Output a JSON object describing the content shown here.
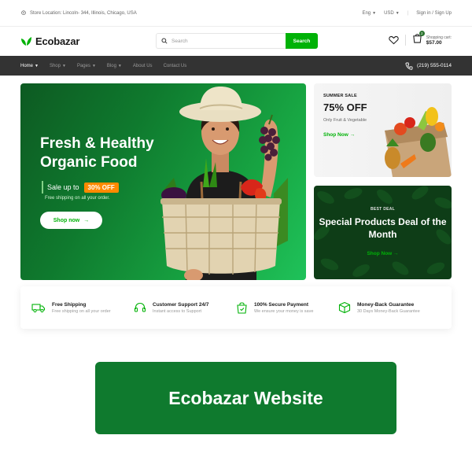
{
  "topbar": {
    "location": "Store Location: Lincoln- 344, Illinois, Chicago, USA",
    "language": "Eng",
    "currency": "USD",
    "sign_in": "Sign in",
    "separator": "/",
    "sign_up": "Sign Up"
  },
  "header": {
    "logo_text": "Ecobazar",
    "search_placeholder": "Search",
    "search_button": "Search",
    "cart_count": "2",
    "cart_label": "Shopping cart:",
    "cart_amount": "$57.00"
  },
  "nav": {
    "items": [
      "Home",
      "Shop",
      "Pages",
      "Blog",
      "About Us",
      "Contact Us"
    ],
    "phone": "(219) 555-0114"
  },
  "hero": {
    "headline": "Fresh & Healthy Organic Food",
    "sale_text": "Sale up to",
    "sale_percent": "30% OFF",
    "shipping_note": "Free shipping on all your order.",
    "button": "Shop now"
  },
  "promo_summer": {
    "eyebrow": "SUMMER SALE",
    "headline": "75% OFF",
    "subtitle": "Only Fruit & Vegetable",
    "link": "Shop Now"
  },
  "promo_deal": {
    "eyebrow": "BEST DEAL",
    "title": "Special Products Deal of the Month",
    "link": "Shop Now"
  },
  "features": [
    {
      "title": "Free Shipping",
      "desc": "Free shipping on all your order",
      "icon": "truck-icon"
    },
    {
      "title": "Customer Support 24/7",
      "desc": "Instant access to Support",
      "icon": "headphones-icon"
    },
    {
      "title": "100% Secure Payment",
      "desc": "We ensure your money is save",
      "icon": "shopping-bag-icon"
    },
    {
      "title": "Money-Back Guarantee",
      "desc": "30 Days Money-Back Guarantee",
      "icon": "package-icon"
    }
  ],
  "caption": "Ecobazar Website",
  "colors": {
    "brand_green": "#00b207",
    "dark_green": "#0f7a2e",
    "nav_bg": "#333333",
    "sale_orange": "#ff8a00"
  }
}
